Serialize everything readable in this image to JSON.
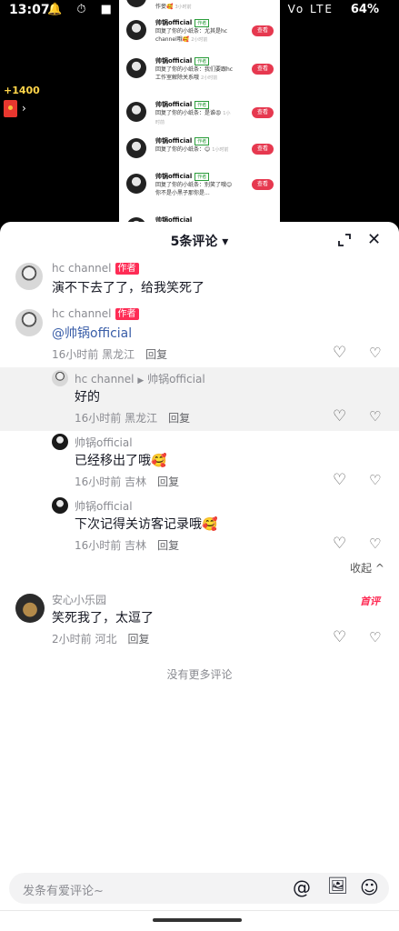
{
  "status_bar": {
    "time": "13:07",
    "left_icons": "🔔 ⏱ ■",
    "network": "Vo LTE",
    "battery": "64%"
  },
  "reward": {
    "label": "+1400",
    "chevron": "›"
  },
  "video_overlay": {
    "rows": [
      {
        "name": "",
        "tag": "",
        "text": "作妾🥰",
        "time": "3小时前",
        "button": ""
      },
      {
        "name": "帅锅official",
        "tag": "作者",
        "text": "回复了你的小纸条：尤其是hc channel哦🥰",
        "time": "2小时前",
        "button": "查看"
      },
      {
        "name": "帅锅official",
        "tag": "作者",
        "text": "回复了你的小纸条：我们要跟hc工作室解除关系哦",
        "time": "2小时前",
        "button": "查看"
      },
      {
        "name": "帅锅official",
        "tag": "作者",
        "text": "回复了你的小纸条：是谁😡",
        "time": "1小时前",
        "button": "查看"
      },
      {
        "name": "帅锅official",
        "tag": "作者",
        "text": "回复了你的小纸条：😊",
        "time": "1小时前",
        "button": "查看"
      },
      {
        "name": "帅锅official",
        "tag": "作者",
        "text": "回复了你的小纸条：别笑了哦😊你不是小黑子那你是...",
        "time": "",
        "button": "查看"
      },
      {
        "name": "帅锅official",
        "tag": "",
        "text": "",
        "time": "",
        "button": ""
      }
    ]
  },
  "panel": {
    "title": "5条评论",
    "title_caret": "▾",
    "close": "✕"
  },
  "comments": [
    {
      "name": "hc channel",
      "tag": "作者",
      "text": "演不下去了了，给我笑死了"
    },
    {
      "name": "hc channel",
      "tag": "作者",
      "text": "@帅锅official",
      "time": "16小时前",
      "location": "黑龙江",
      "reply": "回复"
    }
  ],
  "replies": [
    {
      "name": "hc channel",
      "arrow": "▶",
      "target": "帅锅official",
      "text": "好的",
      "time": "16小时前",
      "location": "黑龙江",
      "reply": "回复"
    },
    {
      "name": "帅锅official",
      "text": "已经移出了哦🥰",
      "time": "16小时前",
      "location": "吉林",
      "reply": "回复"
    },
    {
      "name": "帅锅official",
      "text": "下次记得关访客记录哦🥰",
      "time": "16小时前",
      "location": "吉林",
      "reply": "回复"
    }
  ],
  "collapse_label": "收起",
  "third_comment": {
    "name": "安心小乐园",
    "badge": "首评",
    "text": "笑死我了，太逗了",
    "time": "2小时前",
    "location": "河北",
    "reply": "回复"
  },
  "no_more": "没有更多评论",
  "input": {
    "placeholder": "发条有爱评论~"
  },
  "icons": {
    "like": "♡",
    "dislike": "♡",
    "mention": "@",
    "image": "🖼",
    "emoji": "☺"
  }
}
